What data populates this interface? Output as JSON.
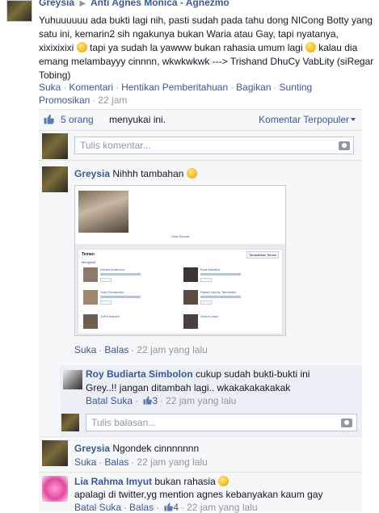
{
  "post": {
    "author": "Greysia",
    "target": "Anti Agnes Monica - Agnezmo",
    "text_before_emo1": "Yuhuuuuuu ada bukti lagi nih, pasti sudah pada tahu dong NICong Botty yang satu ini, kemarin2 sih ngakunya bukan Waria atau Gay, tapi nyatanya, xixixixixi",
    "text_between_emo": " tapi ya sudah la yawww bukan rahasia umum lagi",
    "text_after_emo2": " kalau dia emang melambayyy cinnnn, wkwkwkwk ---> Trishand DhuCy VabLity (siRegar Tobing)",
    "actions": {
      "like": "Suka",
      "comment": "Komentari",
      "stop_notify": "Hentikan Pemberitahuan",
      "share": "Bagikan",
      "edit": "Sunting",
      "promote": "Promosikan",
      "time": "22 jam"
    }
  },
  "likes": {
    "count": "5 orang",
    "rest": "menyukai ini.",
    "sort": "Komentar Terpopuler"
  },
  "composer": {
    "placeholder": "Tulis komentar..."
  },
  "comments": [
    {
      "name": "Greysia",
      "text": "Nihhh tambahan",
      "like": "Suka",
      "reply": "Balas",
      "time": "22 jam yang lalu",
      "screenshot": {
        "link": "Lihat Semua",
        "section": "Teman",
        "subsection": "Mengikuti",
        "button": "Tambahkan Teman",
        "friends": [
          "Gerald Anderson",
          "Ezra Mandira",
          "Yosa Fernandes",
          "Rafael Landry Tanubrata",
          "Zeff Kreanzie",
          "Owens Iman"
        ]
      }
    },
    {
      "name": "Greysia",
      "text": "Ngondek cinnnnnnn",
      "like": "Suka",
      "reply": "Balas",
      "time": "22 jam yang lalu"
    },
    {
      "name": "Lia Rahma Imyut",
      "text_line1": "bukan rahasia",
      "text_line2": "apalagi di twitter,yg mention agnes kebanyakan kaum gay",
      "unlike": "Batal Suka",
      "reply": "Balas",
      "likes": "4",
      "time": "22 jam yang lalu"
    }
  ],
  "reply": {
    "name": "Roy Budiarta Simbolon",
    "text_line1": "cukup sudah bukti-bukti ini",
    "text_line2": "Grey..!! jangan ditambah lagi.. wkakakakakakak",
    "unlike": "Batal Suka",
    "likes": "3",
    "time": "22 jam yang lalu",
    "placeholder": "Tulis balasan..."
  },
  "icons": {
    "thumb": "thumbs-up-icon",
    "camera": "camera-icon",
    "emoticon": "smiley-emoticon-icon"
  },
  "colors": {
    "link": "#3b5998",
    "meta": "#9197a3",
    "feed_bg": "#f6f7f8"
  }
}
